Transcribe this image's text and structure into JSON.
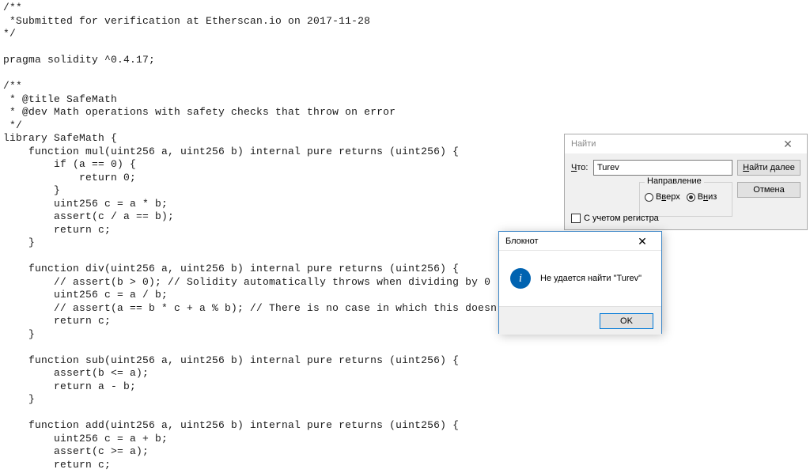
{
  "code": "/**\n *Submitted for verification at Etherscan.io on 2017-11-28\n*/\n\npragma solidity ^0.4.17;\n\n/**\n * @title SafeMath\n * @dev Math operations with safety checks that throw on error\n */\nlibrary SafeMath {\n    function mul(uint256 a, uint256 b) internal pure returns (uint256) {\n        if (a == 0) {\n            return 0;\n        }\n        uint256 c = a * b;\n        assert(c / a == b);\n        return c;\n    }\n\n    function div(uint256 a, uint256 b) internal pure returns (uint256) {\n        // assert(b > 0); // Solidity automatically throws when dividing by 0\n        uint256 c = a / b;\n        // assert(a == b * c + a % b); // There is no case in which this doesn't hold\n        return c;\n    }\n\n    function sub(uint256 a, uint256 b) internal pure returns (uint256) {\n        assert(b <= a);\n        return a - b;\n    }\n\n    function add(uint256 a, uint256 b) internal pure returns (uint256) {\n        uint256 c = a + b;\n        assert(c >= a);\n        return c;",
  "find": {
    "title": "Найти",
    "label": "Что:",
    "value": "Turev",
    "find_next": "Найти далее",
    "cancel": "Отмена",
    "case_sensitive": "С учетом регистра",
    "direction_label": "Направление",
    "up": "Вверх",
    "down": "Вниз"
  },
  "msg": {
    "title": "Блокнот",
    "text": "Не удается найти \"Turev\"",
    "ok": "OK"
  }
}
